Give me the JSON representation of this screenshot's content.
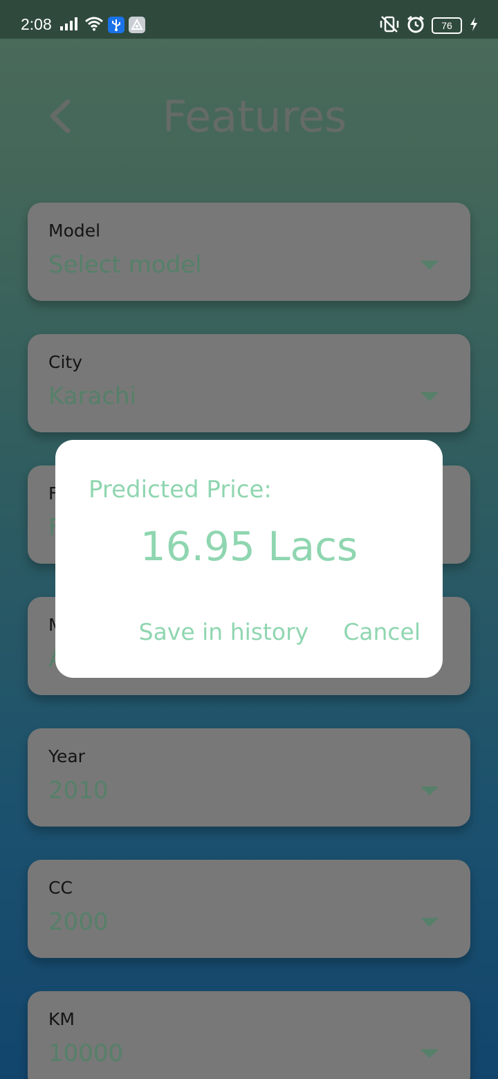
{
  "status_bar": {
    "time": "2:08",
    "battery_level": "76",
    "icons": [
      "signal-icon",
      "wifi-icon",
      "usb-icon",
      "app-notification-icon",
      "vibrate-off-icon",
      "alarm-icon",
      "battery-icon",
      "charging-icon"
    ]
  },
  "header": {
    "title": "Features",
    "back_icon": "chevron-left-icon"
  },
  "form": {
    "fields": [
      {
        "label": "Model",
        "value": "Select model"
      },
      {
        "label": "City",
        "value": "Karachi"
      },
      {
        "label": "F",
        "value": "F"
      },
      {
        "label": "M",
        "value": "A"
      },
      {
        "label": "Year",
        "value": "2010"
      },
      {
        "label": "CC",
        "value": "2000"
      },
      {
        "label": "KM",
        "value": "10000"
      }
    ]
  },
  "dialog": {
    "title": "Predicted Price:",
    "price": "16.95 Lacs",
    "save_label": "Save in history",
    "cancel_label": "Cancel"
  },
  "colors": {
    "accent": "#8fd6b0",
    "card": "#c8c8c8",
    "status_bar": "#2f4a3c",
    "title": "#a9b2aa"
  }
}
